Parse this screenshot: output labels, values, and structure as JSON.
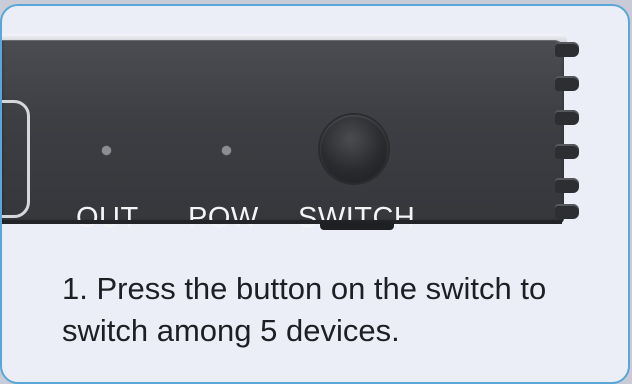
{
  "device": {
    "labels": {
      "out": "OUT",
      "pow": "POW",
      "switch": "SWITCH"
    }
  },
  "caption": {
    "line1": "1. Press the button on the switch to",
    "line2": "switch among 5 devices."
  },
  "colors": {
    "card_border": "#5aa6d8",
    "card_background": "#eceef7",
    "device_body": "#3c3e43",
    "label_text": "#f4f4f6",
    "caption_text": "#1e1f24"
  }
}
